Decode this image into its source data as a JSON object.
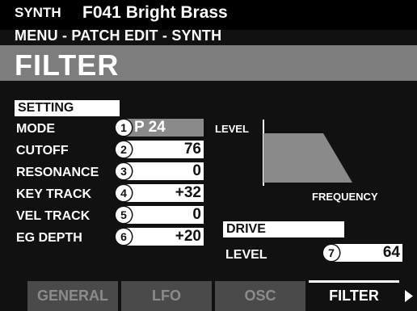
{
  "header": {
    "engine": "SYNTH",
    "patch": "F041 Bright Brass",
    "breadcrumb": "MENU - PATCH EDIT - SYNTH"
  },
  "page_title": "FILTER",
  "setting": {
    "section_label": "SETTING",
    "rows": [
      {
        "label": "MODE",
        "badge": "1",
        "value": "P 24"
      },
      {
        "label": "CUTOFF",
        "badge": "2",
        "value": "76"
      },
      {
        "label": "RESONANCE",
        "badge": "3",
        "value": "0"
      },
      {
        "label": "KEY TRACK",
        "badge": "4",
        "value": "+32"
      },
      {
        "label": "VEL TRACK",
        "badge": "5",
        "value": "0"
      },
      {
        "label": "EG DEPTH",
        "badge": "6",
        "value": "+20"
      }
    ]
  },
  "graph": {
    "y_label": "LEVEL",
    "x_label": "FREQUENCY"
  },
  "drive": {
    "section_label": "DRIVE",
    "label": "LEVEL",
    "badge": "7",
    "value": "64"
  },
  "tabs": [
    {
      "label": "GENERAL",
      "active": false
    },
    {
      "label": "LFO",
      "active": false
    },
    {
      "label": "OSC",
      "active": false
    },
    {
      "label": "FILTER",
      "active": true
    }
  ],
  "next_page_icon": "triangle-right-icon",
  "colors": {
    "background": "#111111",
    "title_bar": "#7d7d7d",
    "value_box": "#ffffff",
    "selected_value": "#8a8a8a",
    "graph_fill": "#8a8a8a",
    "tab_inactive": "#4a4a4a"
  }
}
